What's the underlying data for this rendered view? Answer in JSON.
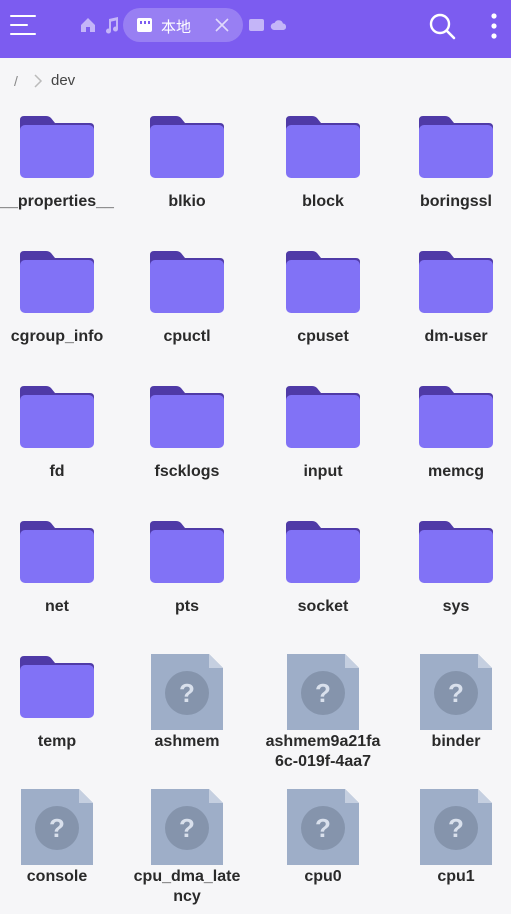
{
  "colors": {
    "accent": "#7c5cf0",
    "folder_front": "#8172f6",
    "folder_back": "#4f3aa7",
    "unknown_file": "#9eaec8",
    "unknown_file_fold": "#c5cfe0",
    "unknown_circle": "#8594ac"
  },
  "topbar": {
    "icons": [
      "menu-icon",
      "home-icon",
      "music-icon",
      "storage-icon",
      "storage-icon",
      "cloud-icon",
      "search-icon",
      "more-vertical-icon"
    ],
    "active_tab": {
      "label": "本地",
      "icon": "storage-icon"
    }
  },
  "breadcrumb": {
    "root": "/",
    "current": "dev"
  },
  "items": [
    {
      "name": "__properties__",
      "type": "folder"
    },
    {
      "name": "blkio",
      "type": "folder"
    },
    {
      "name": "block",
      "type": "folder"
    },
    {
      "name": "boringssl",
      "type": "folder"
    },
    {
      "name": "cgroup_info",
      "type": "folder"
    },
    {
      "name": "cpuctl",
      "type": "folder"
    },
    {
      "name": "cpuset",
      "type": "folder"
    },
    {
      "name": "dm-user",
      "type": "folder"
    },
    {
      "name": "fd",
      "type": "folder"
    },
    {
      "name": "fscklogs",
      "type": "folder"
    },
    {
      "name": "input",
      "type": "folder"
    },
    {
      "name": "memcg",
      "type": "folder"
    },
    {
      "name": "net",
      "type": "folder"
    },
    {
      "name": "pts",
      "type": "folder"
    },
    {
      "name": "socket",
      "type": "folder"
    },
    {
      "name": "sys",
      "type": "folder"
    },
    {
      "name": "temp",
      "type": "folder"
    },
    {
      "name": "ashmem",
      "type": "unknown"
    },
    {
      "name": "ashmem9a21fa6c-019f-4aa7",
      "type": "unknown"
    },
    {
      "name": "binder",
      "type": "unknown"
    },
    {
      "name": "console",
      "type": "unknown"
    },
    {
      "name": "cpu_dma_latency",
      "type": "unknown"
    },
    {
      "name": "cpu0",
      "type": "unknown"
    },
    {
      "name": "cpu1",
      "type": "unknown"
    }
  ]
}
